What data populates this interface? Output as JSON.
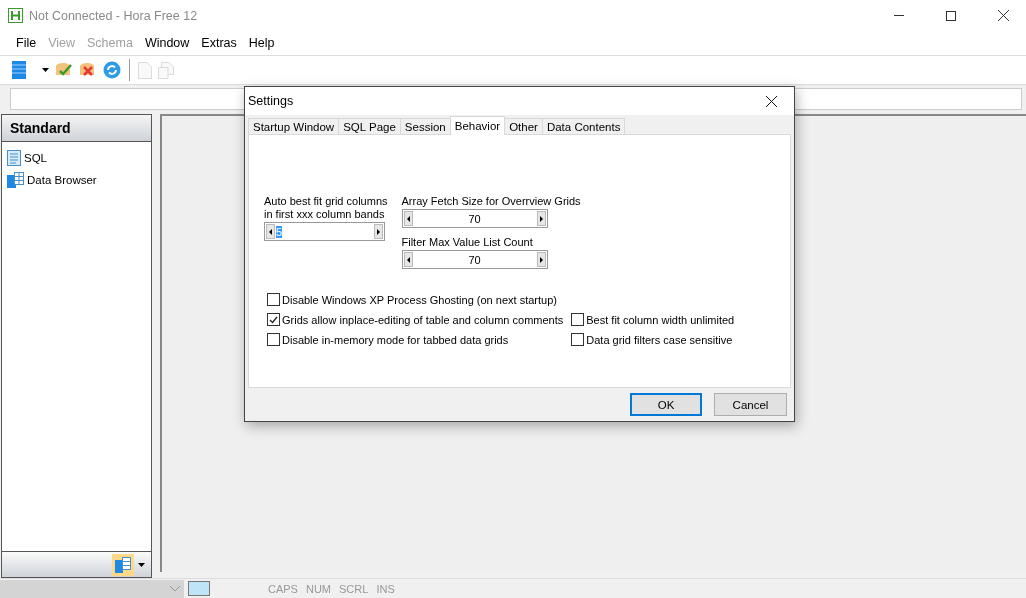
{
  "window": {
    "title": "Not Connected - Hora Free 12"
  },
  "menu": [
    {
      "label": "File",
      "disabled": false
    },
    {
      "label": "View",
      "disabled": true
    },
    {
      "label": "Schema",
      "disabled": true
    },
    {
      "label": "Window",
      "disabled": false
    },
    {
      "label": "Extras",
      "disabled": false
    },
    {
      "label": "Help",
      "disabled": false
    }
  ],
  "toolbar": [
    {
      "kind": "grid",
      "disabled": false
    },
    {
      "kind": "dropdown",
      "disabled": false
    },
    {
      "kind": "connect",
      "disabled": false
    },
    {
      "kind": "disconnect",
      "disabled": false
    },
    {
      "kind": "refresh",
      "disabled": false
    },
    {
      "kind": "separator"
    },
    {
      "kind": "page",
      "disabled": true
    },
    {
      "kind": "pages",
      "disabled": true
    }
  ],
  "sidebar": {
    "title": "Standard",
    "items": [
      {
        "kind": "sql",
        "label": "SQL"
      },
      {
        "kind": "browser",
        "label": "Data Browser"
      }
    ]
  },
  "dialog": {
    "title": "Settings",
    "tabs": [
      {
        "label": "Startup Window",
        "selected": false
      },
      {
        "label": "SQL Page",
        "selected": false
      },
      {
        "label": "Session",
        "selected": false
      },
      {
        "label": "Behavior",
        "selected": true
      },
      {
        "label": "Other",
        "selected": false
      },
      {
        "label": "Data Contents",
        "selected": false
      }
    ],
    "spinners": [
      {
        "label": "Auto best fit grid columns\nin first xxx column bands",
        "value": "5",
        "highlighted": true
      },
      {
        "label": "Array Fetch Size for Overrview Grids",
        "value": "70",
        "highlighted": false
      },
      {
        "label": "Filter Max Value List Count",
        "value": "70",
        "highlighted": false
      }
    ],
    "checkboxes_left": [
      {
        "label": "Disable Windows XP Process Ghosting (on next startup)",
        "checked": false
      },
      {
        "label": "Grids allow inplace-editing of table and column comments",
        "checked": true
      },
      {
        "label": "Disable in-memory mode for tabbed data grids",
        "checked": false
      }
    ],
    "checkboxes_right": [
      {
        "label": "Best fit column width unlimited",
        "checked": false
      },
      {
        "label": "Data grid filters case sensitive",
        "checked": false
      }
    ],
    "buttons": [
      {
        "label": "OK",
        "default": true
      },
      {
        "label": "Cancel",
        "default": false
      }
    ]
  },
  "status_bar": [
    {
      "label": "CAPS"
    },
    {
      "label": "NUM"
    },
    {
      "label": "SCRL"
    },
    {
      "label": "INS"
    }
  ]
}
